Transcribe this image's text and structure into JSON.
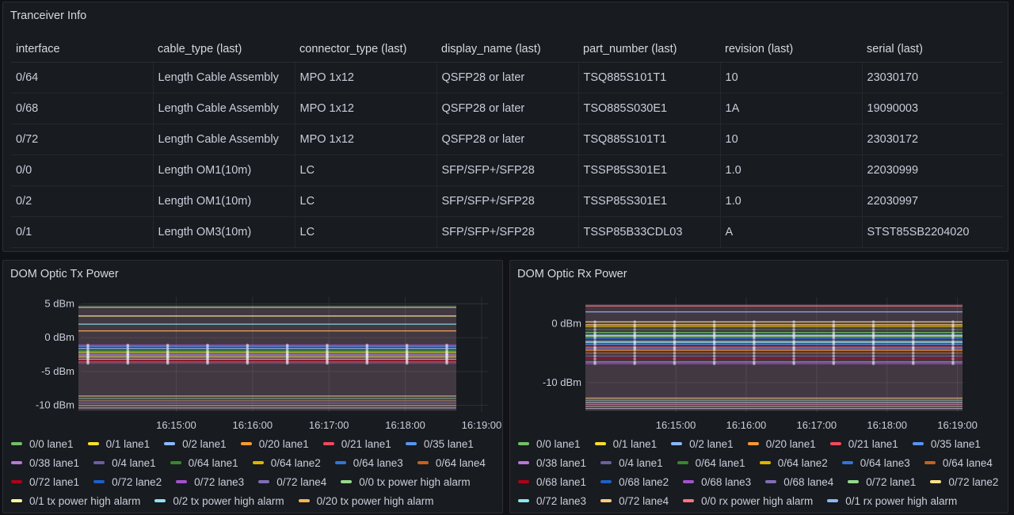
{
  "transceiver": {
    "title": "Tranceiver Info",
    "columns": [
      "interface",
      "cable_type (last)",
      "connector_type (last)",
      "display_name (last)",
      "part_number (last)",
      "revision (last)",
      "serial (last)"
    ],
    "rows": [
      [
        "0/64",
        "Length Cable Assembly",
        "MPO 1x12",
        "QSFP28 or later",
        "TSQ885S101T1",
        "10",
        "23030170"
      ],
      [
        "0/68",
        "Length Cable Assembly",
        "MPO 1x12",
        "QSFP28 or later",
        "TSO885S030E1",
        "1A",
        "19090003"
      ],
      [
        "0/72",
        "Length Cable Assembly",
        "MPO 1x12",
        "QSFP28 or later",
        "TSQ885S101T1",
        "10",
        "23030172"
      ],
      [
        "0/0",
        "Length OM1(10m)",
        "LC",
        "SFP/SFP+/SFP28",
        "TSSP85S301E1",
        "1.0",
        "22030999"
      ],
      [
        "0/2",
        "Length OM1(10m)",
        "LC",
        "SFP/SFP+/SFP28",
        "TSSP85S301E1",
        "1.0",
        "22030997"
      ],
      [
        "0/1",
        "Length OM3(10m)",
        "LC",
        "SFP/SFP+/SFP28",
        "TSSP85B33CDL03",
        "A",
        "STST85SB2204020"
      ]
    ]
  },
  "chart_data": [
    {
      "type": "line",
      "title": "DOM Optic Tx Power",
      "ylim": [
        -11,
        6
      ],
      "y_ticks": [
        5,
        0,
        -5,
        -10
      ],
      "y_tick_labels": [
        "5 dBm",
        "0 dBm",
        "-5 dBm",
        "-10 dBm"
      ],
      "x_ticks": [
        "16:15:00",
        "16:16:00",
        "16:17:00",
        "16:18:00",
        "16:19:00"
      ],
      "x_range": [
        "16:13:45",
        "16:19:05"
      ],
      "grid": true,
      "legend_placement": "bottom",
      "series": [
        {
          "name": "0/0 lane1",
          "color": "#73bf69",
          "values": [
            -2.2,
            -2.2,
            -2.2,
            -2.2,
            -2.2
          ]
        },
        {
          "name": "0/1 lane1",
          "color": "#fade2a",
          "values": [
            -2.8,
            -2.8,
            -2.8,
            -2.8,
            -2.8
          ]
        },
        {
          "name": "0/2 lane1",
          "color": "#8ab8ff",
          "values": [
            -1.6,
            -1.6,
            -1.6,
            -1.6,
            -1.6
          ]
        },
        {
          "name": "0/20 lane1",
          "color": "#ff9830",
          "values": [
            -3.2,
            -3.2,
            -3.2,
            -3.2,
            -3.2
          ]
        },
        {
          "name": "0/21 lane1",
          "color": "#f2495c",
          "values": [
            -3.6,
            -3.6,
            -3.6,
            -3.6,
            -3.6
          ]
        },
        {
          "name": "0/35 lane1",
          "color": "#5794f2",
          "values": [
            -1.3,
            -1.3,
            -1.3,
            -1.3,
            -1.3
          ]
        },
        {
          "name": "0/38 lane1",
          "color": "#b877d9",
          "values": [
            -2.5,
            -2.5,
            -2.5,
            -2.5,
            -2.5
          ]
        },
        {
          "name": "0/4 lane1",
          "color": "#705da0",
          "values": [
            -3.0,
            -3.0,
            -3.0,
            -3.0,
            -3.0
          ]
        },
        {
          "name": "0/64 lane1",
          "color": "#37872d",
          "values": [
            -1.9,
            -1.9,
            -1.9,
            -1.9,
            -1.9
          ]
        },
        {
          "name": "0/64 lane2",
          "color": "#e0b400",
          "values": [
            -2.1,
            -2.1,
            -2.1,
            -2.1,
            -2.1
          ]
        },
        {
          "name": "0/64 lane3",
          "color": "#3274d9",
          "values": [
            -2.4,
            -2.4,
            -2.4,
            -2.4,
            -2.4
          ]
        },
        {
          "name": "0/64 lane4",
          "color": "#c4621d",
          "values": [
            -2.6,
            -2.6,
            -2.6,
            -2.6,
            -2.6
          ]
        },
        {
          "name": "0/72 lane1",
          "color": "#ad0317",
          "values": [
            -3.4,
            -3.4,
            -3.4,
            -3.4,
            -3.4
          ]
        },
        {
          "name": "0/72 lane2",
          "color": "#1f60c4",
          "values": [
            -3.8,
            -3.8,
            -3.8,
            -3.8,
            -3.8
          ]
        },
        {
          "name": "0/72 lane3",
          "color": "#a352cc",
          "values": [
            -1.1,
            -1.1,
            -1.1,
            -1.1,
            -1.1
          ]
        },
        {
          "name": "0/72 lane4",
          "color": "#806eb7",
          "values": [
            -2.9,
            -2.9,
            -2.9,
            -2.9,
            -2.9
          ]
        },
        {
          "name": "0/0 tx power high alarm",
          "color": "#96d98d",
          "values": [
            4.5,
            4.5,
            4.5,
            4.5,
            4.5
          ]
        },
        {
          "name": "0/1 tx power high alarm",
          "color": "#fff899",
          "values": [
            3.2,
            3.2,
            3.2,
            3.2,
            3.2
          ]
        },
        {
          "name": "0/2 tx power high alarm",
          "color": "#8ae6f0",
          "values": [
            2.0,
            2.0,
            2.0,
            2.0,
            2.0
          ]
        },
        {
          "name": "0/20 tx power high alarm",
          "color": "#ffb357",
          "values": [
            1.0,
            1.0,
            1.0,
            1.0,
            1.0
          ]
        }
      ]
    },
    {
      "type": "line",
      "title": "DOM Optic Rx Power",
      "ylim": [
        -15,
        4.5
      ],
      "y_ticks": [
        0,
        -10
      ],
      "y_tick_labels": [
        "0 dBm",
        "-10 dBm"
      ],
      "x_ticks": [
        "16:15:00",
        "16:16:00",
        "16:17:00",
        "16:18:00",
        "16:19:00"
      ],
      "x_range": [
        "16:13:45",
        "16:19:05"
      ],
      "grid": true,
      "legend_placement": "bottom",
      "series": [
        {
          "name": "0/0 lane1",
          "color": "#73bf69",
          "values": [
            -1.5,
            -1.5,
            -1.5,
            -1.5,
            -1.5
          ]
        },
        {
          "name": "0/1 lane1",
          "color": "#fade2a",
          "values": [
            -2.0,
            -2.0,
            -2.0,
            -2.0,
            -2.0
          ]
        },
        {
          "name": "0/2 lane1",
          "color": "#8ab8ff",
          "values": [
            -3.0,
            -3.0,
            -3.0,
            -3.0,
            -3.0
          ]
        },
        {
          "name": "0/20 lane1",
          "color": "#ff9830",
          "values": [
            -4.5,
            -4.5,
            -4.5,
            -4.5,
            -4.5
          ]
        },
        {
          "name": "0/21 lane1",
          "color": "#f2495c",
          "values": [
            -4.0,
            -4.0,
            -4.0,
            -4.0,
            -4.0
          ]
        },
        {
          "name": "0/35 lane1",
          "color": "#5794f2",
          "values": [
            -3.5,
            -3.5,
            -3.5,
            -3.5,
            -3.5
          ]
        },
        {
          "name": "0/38 lane1",
          "color": "#b877d9",
          "values": [
            -6.5,
            -6.5,
            -6.5,
            -6.5,
            -6.5
          ]
        },
        {
          "name": "0/4 lane1",
          "color": "#705da0",
          "values": [
            -5.5,
            -5.5,
            -5.5,
            -5.5,
            -5.5
          ]
        },
        {
          "name": "0/64 lane1",
          "color": "#37872d",
          "values": [
            -1.0,
            -1.0,
            -1.0,
            -1.0,
            -1.0
          ]
        },
        {
          "name": "0/64 lane2",
          "color": "#e0b400",
          "values": [
            -0.5,
            -0.5,
            -0.5,
            -0.5,
            -0.5
          ]
        },
        {
          "name": "0/64 lane3",
          "color": "#3274d9",
          "values": [
            -2.5,
            -2.5,
            -2.5,
            -2.5,
            -2.5
          ]
        },
        {
          "name": "0/64 lane4",
          "color": "#c4621d",
          "values": [
            -5.0,
            -5.0,
            -5.0,
            -5.0,
            -5.0
          ]
        },
        {
          "name": "0/68 lane1",
          "color": "#ad0317",
          "values": [
            -6.0,
            -6.0,
            -6.0,
            -6.0,
            -6.0
          ]
        },
        {
          "name": "0/68 lane2",
          "color": "#1f60c4",
          "values": [
            -1.8,
            -1.8,
            -1.8,
            -1.8,
            -1.8
          ]
        },
        {
          "name": "0/68 lane3",
          "color": "#a352cc",
          "values": [
            -6.8,
            -6.8,
            -6.8,
            -6.8,
            -6.8
          ]
        },
        {
          "name": "0/68 lane4",
          "color": "#806eb7",
          "values": [
            -4.2,
            -4.2,
            -4.2,
            -4.2,
            -4.2
          ]
        },
        {
          "name": "0/72 lane1",
          "color": "#96d98d",
          "values": [
            -2.2,
            -2.2,
            -2.2,
            -2.2,
            -2.2
          ]
        },
        {
          "name": "0/72 lane2",
          "color": "#ffe08a",
          "values": [
            0.3,
            0.3,
            0.3,
            0.3,
            0.3
          ]
        },
        {
          "name": "0/72 lane3",
          "color": "#8ae6f0",
          "values": [
            -3.2,
            -3.2,
            -3.2,
            -3.2,
            -3.2
          ]
        },
        {
          "name": "0/72 lane4",
          "color": "#ffcb7d",
          "values": [
            -0.2,
            -0.2,
            -0.2,
            -0.2,
            -0.2
          ]
        },
        {
          "name": "0/0 rx power high alarm",
          "color": "#ff7383",
          "values": [
            3.0,
            3.0,
            3.0,
            3.0,
            3.0
          ]
        },
        {
          "name": "0/1 rx power high alarm",
          "color": "#8ab8ff",
          "values": [
            2.0,
            2.0,
            2.0,
            2.0,
            2.0
          ]
        }
      ]
    }
  ]
}
